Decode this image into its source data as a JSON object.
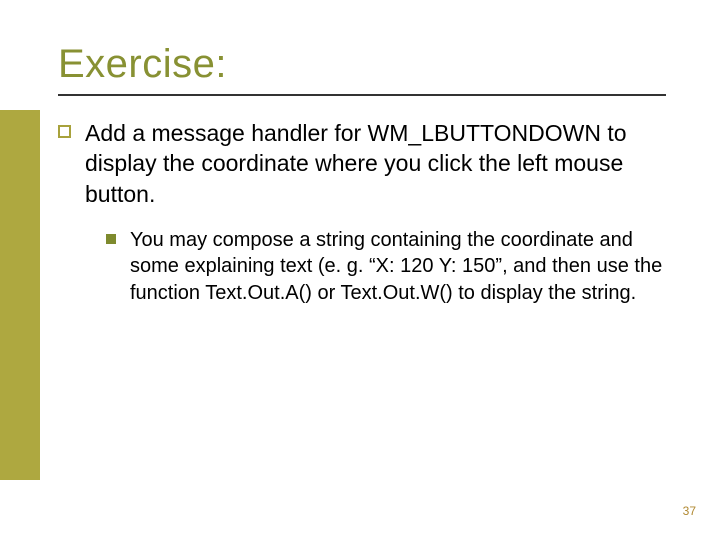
{
  "title": "Exercise:",
  "bullets": {
    "level1": "Add a message handler for WM_LBUTTONDOWN to display the coordinate where you click the left mouse button.",
    "level2": "You may compose a string containing the coordinate and some explaining text (e. g. “X: 120 Y: 150”, and then use the function Text.Out.A() or Text.Out.W() to display the string."
  },
  "page_number": "37"
}
